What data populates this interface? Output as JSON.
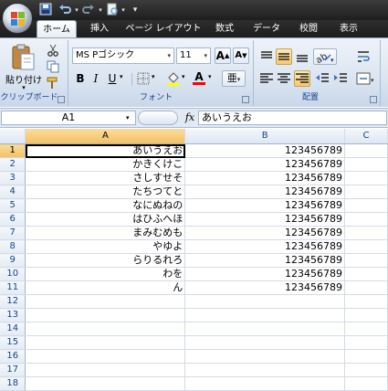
{
  "qat": {
    "undo_icon": "undo-arrow",
    "redo_icon": "redo-arrow",
    "save_icon": "floppy-disk",
    "customize": "▾"
  },
  "tabs": [
    "ホーム",
    "挿入",
    "ページ レイアウト",
    "数式",
    "データ",
    "校閲",
    "表示"
  ],
  "ribbon": {
    "clipboard": {
      "paste_label": "貼り付け",
      "group_label": "クリップボード"
    },
    "font": {
      "font_name": "MS Pゴシック",
      "font_size": "11",
      "bold": "B",
      "italic": "I",
      "underline": "U",
      "grow": "A",
      "shrink": "A",
      "font_color": "A",
      "phonetic": "亜",
      "group_label": "フォント"
    },
    "alignment": {
      "group_label": "配置"
    }
  },
  "formula_bar": {
    "name_box": "A1",
    "fx": "fx",
    "content": "あいうえお"
  },
  "sheet": {
    "columns": [
      "A",
      "B",
      "C"
    ],
    "rows": [
      {
        "n": "1",
        "a": "あいうえお",
        "b": "123456789"
      },
      {
        "n": "2",
        "a": "かきくけこ",
        "b": "123456789"
      },
      {
        "n": "3",
        "a": "さしすせそ",
        "b": "123456789"
      },
      {
        "n": "4",
        "a": "たちつてと",
        "b": "123456789"
      },
      {
        "n": "5",
        "a": "なにぬねの",
        "b": "123456789"
      },
      {
        "n": "6",
        "a": "はひふへほ",
        "b": "123456789"
      },
      {
        "n": "7",
        "a": "まみむめも",
        "b": "123456789"
      },
      {
        "n": "8",
        "a": "やゆよ",
        "b": "123456789"
      },
      {
        "n": "9",
        "a": "らりるれろ",
        "b": "123456789"
      },
      {
        "n": "10",
        "a": "わを",
        "b": "123456789"
      },
      {
        "n": "11",
        "a": "ん",
        "b": "123456789"
      },
      {
        "n": "12",
        "a": "",
        "b": ""
      },
      {
        "n": "13",
        "a": "",
        "b": ""
      },
      {
        "n": "14",
        "a": "",
        "b": ""
      },
      {
        "n": "15",
        "a": "",
        "b": ""
      },
      {
        "n": "16",
        "a": "",
        "b": ""
      },
      {
        "n": "17",
        "a": "",
        "b": ""
      },
      {
        "n": "18",
        "a": "",
        "b": ""
      }
    ]
  },
  "colors": {
    "ribbon_bg": "#dbe5f1",
    "group_label": "#15428b",
    "selected_header": "#f5c061",
    "titlebar": "#2a2a2a"
  }
}
